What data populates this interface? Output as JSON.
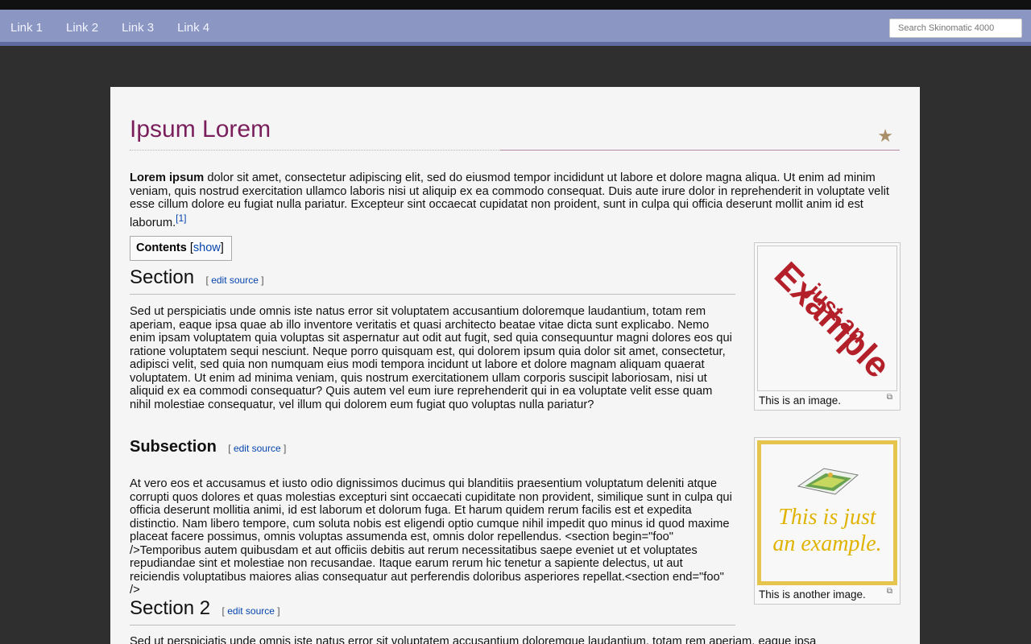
{
  "nav": {
    "links": [
      "Link 1",
      "Link 2",
      "Link 3",
      "Link 4"
    ],
    "search_placeholder": "Search Skinomatic 4000"
  },
  "page": {
    "title": "Ipsum Lorem",
    "lead_bold": "Lorem ipsum",
    "lead_text": " dolor sit amet, consectetur adipiscing elit, sed do eiusmod tempor incididunt ut labore et dolore magna aliqua. Ut enim ad minim veniam, quis nostrud exercitation ullamco laboris nisi ut aliquip ex ea commodo consequat. Duis aute irure dolor in reprehenderit in voluptate velit esse cillum dolore eu fugiat nulla pariatur. Excepteur sint occaecat cupidatat non proident, sunt in culpa qui officia deserunt mollit anim id est laborum.",
    "lead_ref": "[1]"
  },
  "toc": {
    "label": "Contents",
    "bracket_open": "[",
    "toggle": "show",
    "bracket_close": "]"
  },
  "edit": {
    "open": "[",
    "label": "edit source",
    "close": "]"
  },
  "sections": [
    {
      "heading": "Section",
      "text": "Sed ut perspiciatis unde omnis iste natus error sit voluptatem accusantium doloremque laudantium, totam rem aperiam, eaque ipsa quae ab illo inventore veritatis et quasi architecto beatae vitae dicta sunt explicabo. Nemo enim ipsam voluptatem quia voluptas sit aspernatur aut odit aut fugit, sed quia consequuntur magni dolores eos qui ratione voluptatem sequi nesciunt. Neque porro quisquam est, qui dolorem ipsum quia dolor sit amet, consectetur, adipisci velit, sed quia non numquam eius modi tempora incidunt ut labore et dolore magnam aliquam quaerat voluptatem. Ut enim ad minima veniam, quis nostrum exercitationem ullam corporis suscipit laboriosam, nisi ut aliquid ex ea commodi consequatur? Quis autem vel eum iure reprehenderit qui in ea voluptate velit esse quam nihil molestiae consequatur, vel illum qui dolorem eum fugiat quo voluptas nulla pariatur?"
    },
    {
      "heading": "Subsection",
      "text": "At vero eos et accusamus et iusto odio dignissimos ducimus qui blanditiis praesentium voluptatum deleniti atque corrupti quos dolores et quas molestias excepturi sint occaecati cupiditate non provident, similique sunt in culpa qui officia deserunt mollitia animi, id est laborum et dolorum fuga. Et harum quidem rerum facilis est et expedita distinctio. Nam libero tempore, cum soluta nobis est eligendi optio cumque nihil impedit quo minus id quod maxime placeat facere possimus, omnis voluptas assumenda est, omnis dolor repellendus. <section begin=\"foo\" />Temporibus autem quibusdam et aut officiis debitis aut rerum necessitatibus saepe eveniet ut et voluptates repudiandae sint et molestiae non recusandae. Itaque earum rerum hic tenetur a sapiente delectus, ut aut reiciendis voluptatibus maiores alias consequatur aut perferendis doloribus asperiores repellat.<section end=\"foo\" />"
    },
    {
      "heading": "Section 2",
      "text": "Sed ut perspiciatis unde omnis iste natus error sit voluptatem accusantium doloremque laudantium, totam rem aperiam, eaque ipsa"
    }
  ],
  "images": [
    {
      "caption": "This is an image.",
      "art_line1": "just an",
      "art_line2": "Example"
    },
    {
      "caption": "This is another image.",
      "art_line1": "This is just",
      "art_line2": "an example."
    }
  ],
  "colors": {
    "nav": "#8b96c3",
    "title": "#7a1e5c",
    "link": "#0645ad",
    "example_red": "#b4202a",
    "example_gold": "#e0b300"
  }
}
